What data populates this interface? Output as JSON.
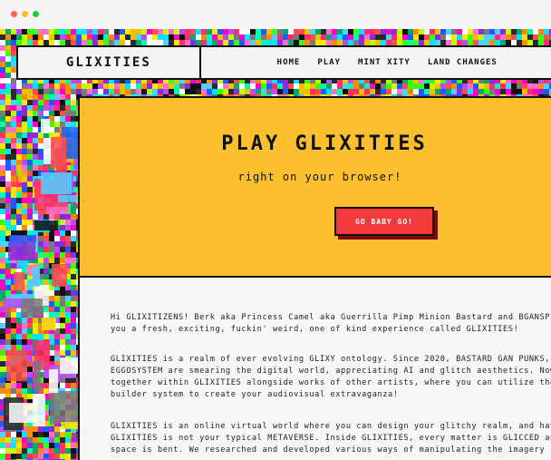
{
  "browser": {
    "controls": [
      "close",
      "minimize",
      "maximize"
    ]
  },
  "header": {
    "logo": "GLIXITIES",
    "nav": [
      {
        "label": "HOME"
      },
      {
        "label": "PLAY"
      },
      {
        "label": "MINT XITY"
      },
      {
        "label": "LAND CHANGES"
      }
    ]
  },
  "hero": {
    "title": "PLAY GLIXITIES",
    "subtitle": "right on your browser!",
    "cta_label": "GO BABY GO!"
  },
  "content": {
    "paragraphs": [
      {
        "lines": [
          "Hi GLIXITIZENS! Berk aka Princess Camel aka Guerrilla Pimp Minion Bastard and BGANSPIEL",
          "you a fresh, exciting, fuckin' weird, one of kind experience called GLIXITIES!"
        ]
      },
      {
        "lines": [
          "GLIXITIES is a realm of ever evolving GLIXY ontology. Since 2020, BASTARD GAN PUNKS, GLI",
          "EGGOSYSTEM are smearing the digital world, appreciating AI and glitch aesthetics. Now",
          "together within GLIXITIES alongside works of other artists, where you can utilize them",
          "builder system to create your audiovisual extravaganza!"
        ]
      },
      {
        "lines": [
          "GLIXITIES is an online virtual world where you can design your glitchy realm, and have f",
          "GLIXITIES is not your typical METAVERSE. Inside GLIXITIES, every matter is GLICCED and C",
          "space is bent. We researched and developed various ways of manipulating the imagery"
        ]
      }
    ]
  },
  "colors": {
    "hero_bg": "#fcc02f",
    "cta_bg": "#f23a3a",
    "cta_shadow": "#7a0b0b",
    "panel_bg": "#f6f6f6"
  }
}
